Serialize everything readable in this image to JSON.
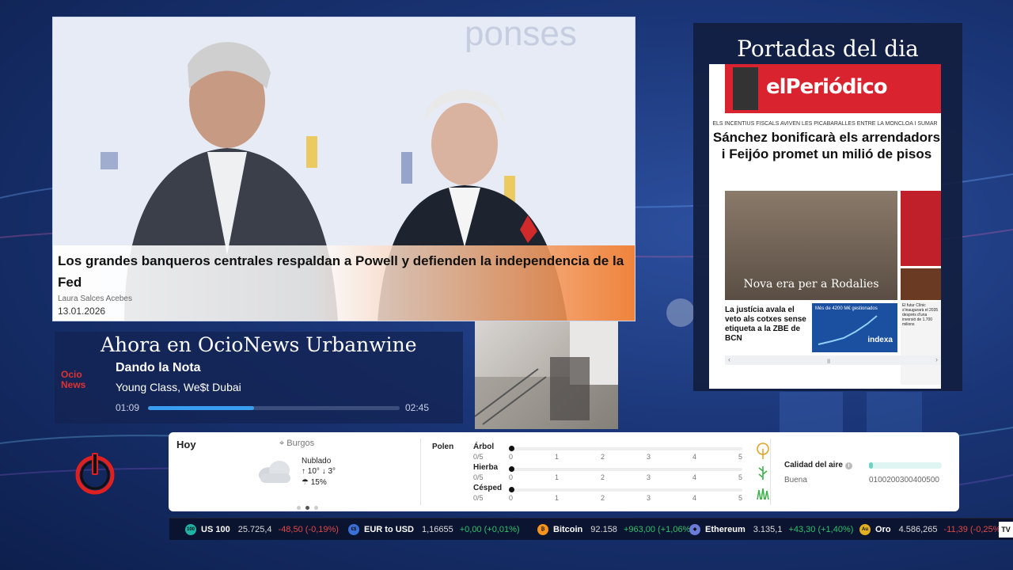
{
  "news": {
    "headline": "Los grandes banqueros centrales respaldan a Powell y defienden la independencia de la Fed",
    "author": "Laura Salces Acebes",
    "date": "13.01.2026"
  },
  "portadas": {
    "title": "Portadas del dia",
    "paper": {
      "logo": "elPeriódico",
      "kicker": "ELS INCENTIUS FISCALS AVIVEN LES PICABARALLES ENTRE LA MONCLOA I SUMAR",
      "headline": "Sánchez bonificarà els arrendadors i Feijóo promet un milió de pisos",
      "photo_caption": "Nova era per a Rodalies",
      "story": "La justícia avala el veto als cotxes sense etiqueta a la ZBE de BCN",
      "side_story": "El futur Clínic s'inaugurarà el 2035 després d'una inversió de 1.700 milions",
      "chart_label": "Més de 4200 M€ gestionados",
      "chart_brand": "indexa"
    }
  },
  "now_playing": {
    "heading": "Ahora en OcioNews Urbanwine",
    "logo_text": "Ocio News",
    "title": "Dando la Nota",
    "artist": "Young Class, We$t Dubai",
    "elapsed": "01:09",
    "duration": "02:45",
    "progress": 0.42
  },
  "weather": {
    "today_label": "Hoy",
    "location": "Burgos",
    "condition": "Nublado",
    "temp_high": "10°",
    "temp_low": "3°",
    "rain": "15%",
    "pollen_label": "Polen",
    "pollen": [
      {
        "name": "Árbol",
        "score": "0/5",
        "icon": "tree-icon"
      },
      {
        "name": "Hierba",
        "score": "0/5",
        "icon": "grass-icon"
      },
      {
        "name": "Césped",
        "score": "0/5",
        "icon": "lawn-icon"
      }
    ],
    "pollen_ticks": [
      "0",
      "1",
      "2",
      "3",
      "4",
      "5"
    ],
    "air_quality_label": "Calidad del aire",
    "air_quality_status": "Buena",
    "air_quality_ticks": "0100200300400500",
    "air_quality_value": 0.05
  },
  "ticker": [
    {
      "badge": "100",
      "name": "US 100",
      "price": "25.725,4",
      "change": "-48,50 (-0,19%)",
      "dir": "down",
      "color": "#1fb3a6"
    },
    {
      "badge": "€$",
      "name": "EUR to USD",
      "price": "1,16655",
      "change": "+0,00 (+0,01%)",
      "dir": "up",
      "color": "#3b6fd8"
    },
    {
      "badge": "₿",
      "name": "Bitcoin",
      "price": "92.158",
      "change": "+963,00 (+1,06%)",
      "dir": "up",
      "color": "#f7931a"
    },
    {
      "badge": "◆",
      "name": "Ethereum",
      "price": "3.135,1",
      "change": "+43,30 (+1,40%)",
      "dir": "up",
      "color": "#6c7bd9"
    },
    {
      "badge": "Au",
      "name": "Oro",
      "price": "4.586,265",
      "change": "-11,39 (-0,25%)",
      "dir": "down",
      "color": "#e0b020"
    }
  ],
  "ticker_logo": "TV"
}
